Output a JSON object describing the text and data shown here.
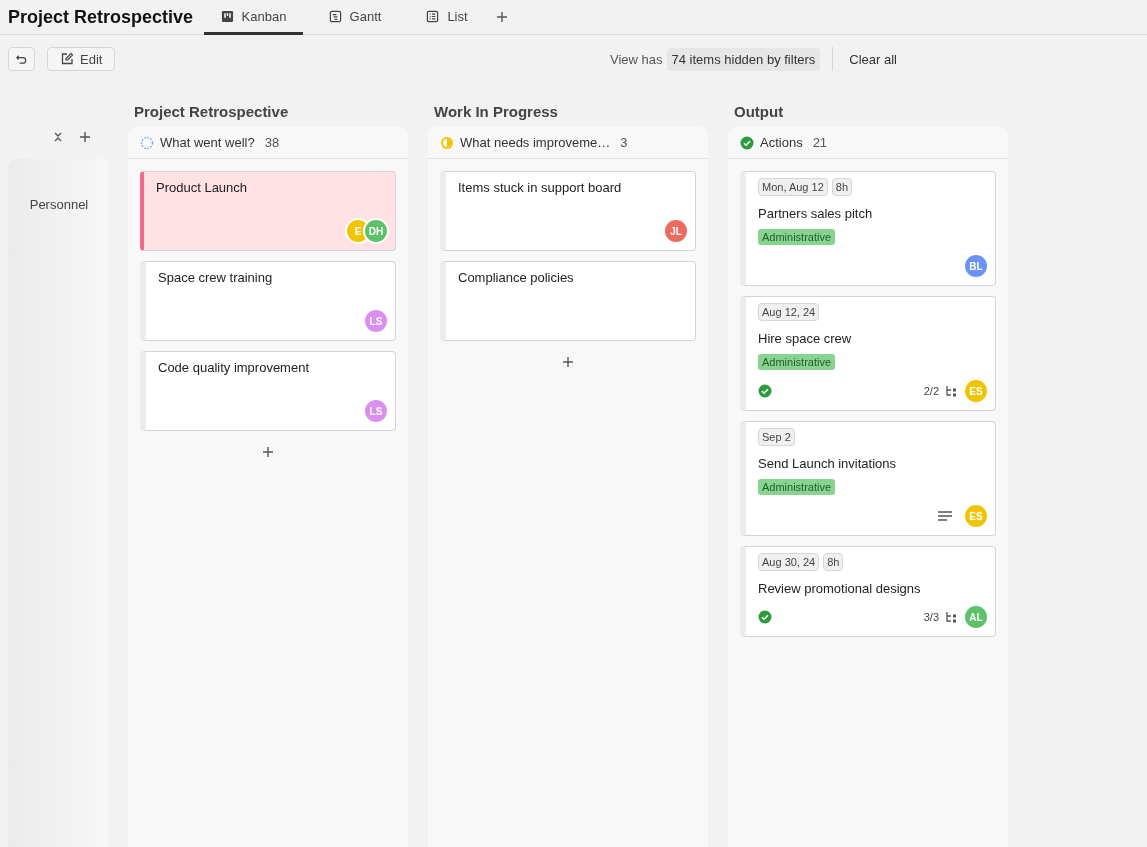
{
  "title": "Project Retrospective",
  "tabs": [
    {
      "label": "Kanban",
      "kind": "kanban",
      "selected": true
    },
    {
      "label": "Gantt",
      "kind": "gantt",
      "selected": false
    },
    {
      "label": "List",
      "kind": "list",
      "selected": false
    }
  ],
  "toolbar": {
    "edit": "Edit",
    "filter_prefix": "View has",
    "filter_badge": "74 items hidden by filters",
    "clear": "Clear all"
  },
  "lane": {
    "label": "Personnel"
  },
  "groups": [
    {
      "title": "Project Retrospective",
      "status": {
        "kind": "todo",
        "label": "What went well?",
        "count": "38"
      },
      "can_add": true,
      "cards": [
        {
          "title": "Product Launch",
          "highlighted": true,
          "avatars": [
            {
              "initials": "E",
              "color": "#f0c400"
            },
            {
              "initials": "DH",
              "color": "#5cc168"
            }
          ]
        },
        {
          "title": "Space crew training",
          "highlighted": false,
          "avatars": [
            {
              "initials": "LS",
              "color": "#d98ef0"
            }
          ]
        },
        {
          "title": "Code quality improvement",
          "highlighted": false,
          "avatars": [
            {
              "initials": "LS",
              "color": "#d98ef0"
            }
          ]
        }
      ]
    },
    {
      "title": "Work In Progress",
      "status": {
        "kind": "progress",
        "label": "What needs improveme…",
        "count": "3"
      },
      "can_add": true,
      "cards": [
        {
          "title": "Items stuck in support board",
          "highlighted": false,
          "avatars": [
            {
              "initials": "JL",
              "color": "#ec6a5e"
            }
          ]
        },
        {
          "title": "Compliance policies",
          "highlighted": false
        }
      ]
    },
    {
      "title": "Output",
      "status": {
        "kind": "done",
        "label": "Actions",
        "count": "21"
      },
      "cards": [
        {
          "title": "Partners sales pitch",
          "highlighted": false,
          "chips": [
            "Mon, Aug 12",
            "8h"
          ],
          "tag": "Administrative",
          "done": false,
          "avatars": [
            {
              "initials": "BL",
              "color": "#6b93f5"
            }
          ]
        },
        {
          "title": "Hire space crew",
          "highlighted": false,
          "chips": [
            "Aug 12, 24"
          ],
          "tag": "Administrative",
          "done": true,
          "subtasks": "2/2",
          "avatars": [
            {
              "initials": "ES",
              "color": "#f0c400"
            }
          ]
        },
        {
          "title": "Send Launch invitations",
          "highlighted": false,
          "chips": [
            "Sep 2"
          ],
          "tag": "Administrative",
          "done": false,
          "has_description": true,
          "avatars": [
            {
              "initials": "ES",
              "color": "#f0c400"
            }
          ]
        },
        {
          "title": "Review promotional designs",
          "highlighted": false,
          "chips": [
            "Aug 30, 24",
            "8h"
          ],
          "done": true,
          "subtasks": "3/3",
          "avatars": [
            {
              "initials": "AL",
              "color": "#5cc168"
            }
          ]
        }
      ]
    }
  ]
}
